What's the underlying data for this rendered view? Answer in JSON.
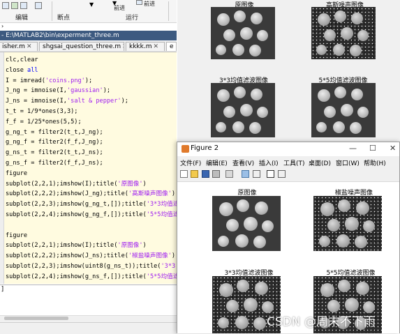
{
  "toolstrip": {
    "labels": [
      "编辑",
      "断点",
      "运行"
    ],
    "button_labels": [
      "前进",
      "前进"
    ]
  },
  "editor": {
    "path": "- E:\\MATLAB2\\bin\\experment_three.m",
    "tabs": [
      "isher.m",
      "shgsai_question_three.m",
      "kkkk.m",
      "e"
    ],
    "code": [
      "clc,clear",
      "close all",
      "I = imread('coins.png');",
      "J_ng = imnoise(I,'gaussian');",
      "J_ns = imnoise(I,'salt & pepper');",
      "t_t = 1/9*ones(3,3);",
      "f_f = 1/25*ones(5,5);",
      "g_ng_t = filter2(t_t,J_ng);",
      "g_ng_f = filter2(f_f,J_ng);",
      "g_ns_t = filter2(t_t,J_ns);",
      "g_ns_f = filter2(f_f,J_ns);",
      "figure",
      "subplot(2,2,1);imshow(I);title('原图像')",
      "subplot(2,2,2);imshow(J_ng);title('高斯噪声图像')",
      "subplot(2,2,3);imshow(g_ng_t,[]);title('3*3均值滤",
      "subplot(2,2,4);imshow(g_ng_f,[]);title('5*5均值滤",
      "",
      "figure",
      "subplot(2,2,1);imshow(I);title('原图像')",
      "subplot(2,2,2);imshow(J_ns);title('椒盐噪声图像')",
      "subplot(2,2,3);imshow(uint8(g_ns_t));title('3*3",
      "subplot(2,2,4);imshow(g_ns_f,[]);title('5*5均值滤"
    ],
    "command_prompt": "]"
  },
  "figure1": {
    "titles": [
      "原图像",
      "高斯噪声图像",
      "3*3均值滤波图像",
      "5*5均值滤波图像"
    ]
  },
  "figure2": {
    "window_title": "Figure 2",
    "menu": [
      "文件(F)",
      "编辑(E)",
      "查看(V)",
      "插入(I)",
      "工具(T)",
      "桌面(D)",
      "窗口(W)",
      "帮助(H)"
    ],
    "titles": [
      "原图像",
      "椒盐噪声图像",
      "3*3均值滤波图像",
      "5*5均值滤波图像"
    ],
    "controls": {
      "minimize": "—",
      "maximize": "☐",
      "close": "✕"
    }
  },
  "watermark": "CSDN @周末不下雨",
  "colors": {
    "editor_bg": "#fffbe0",
    "path_bar": "#3d5a80",
    "keyword": "#0000ff",
    "string": "#a020f0"
  }
}
